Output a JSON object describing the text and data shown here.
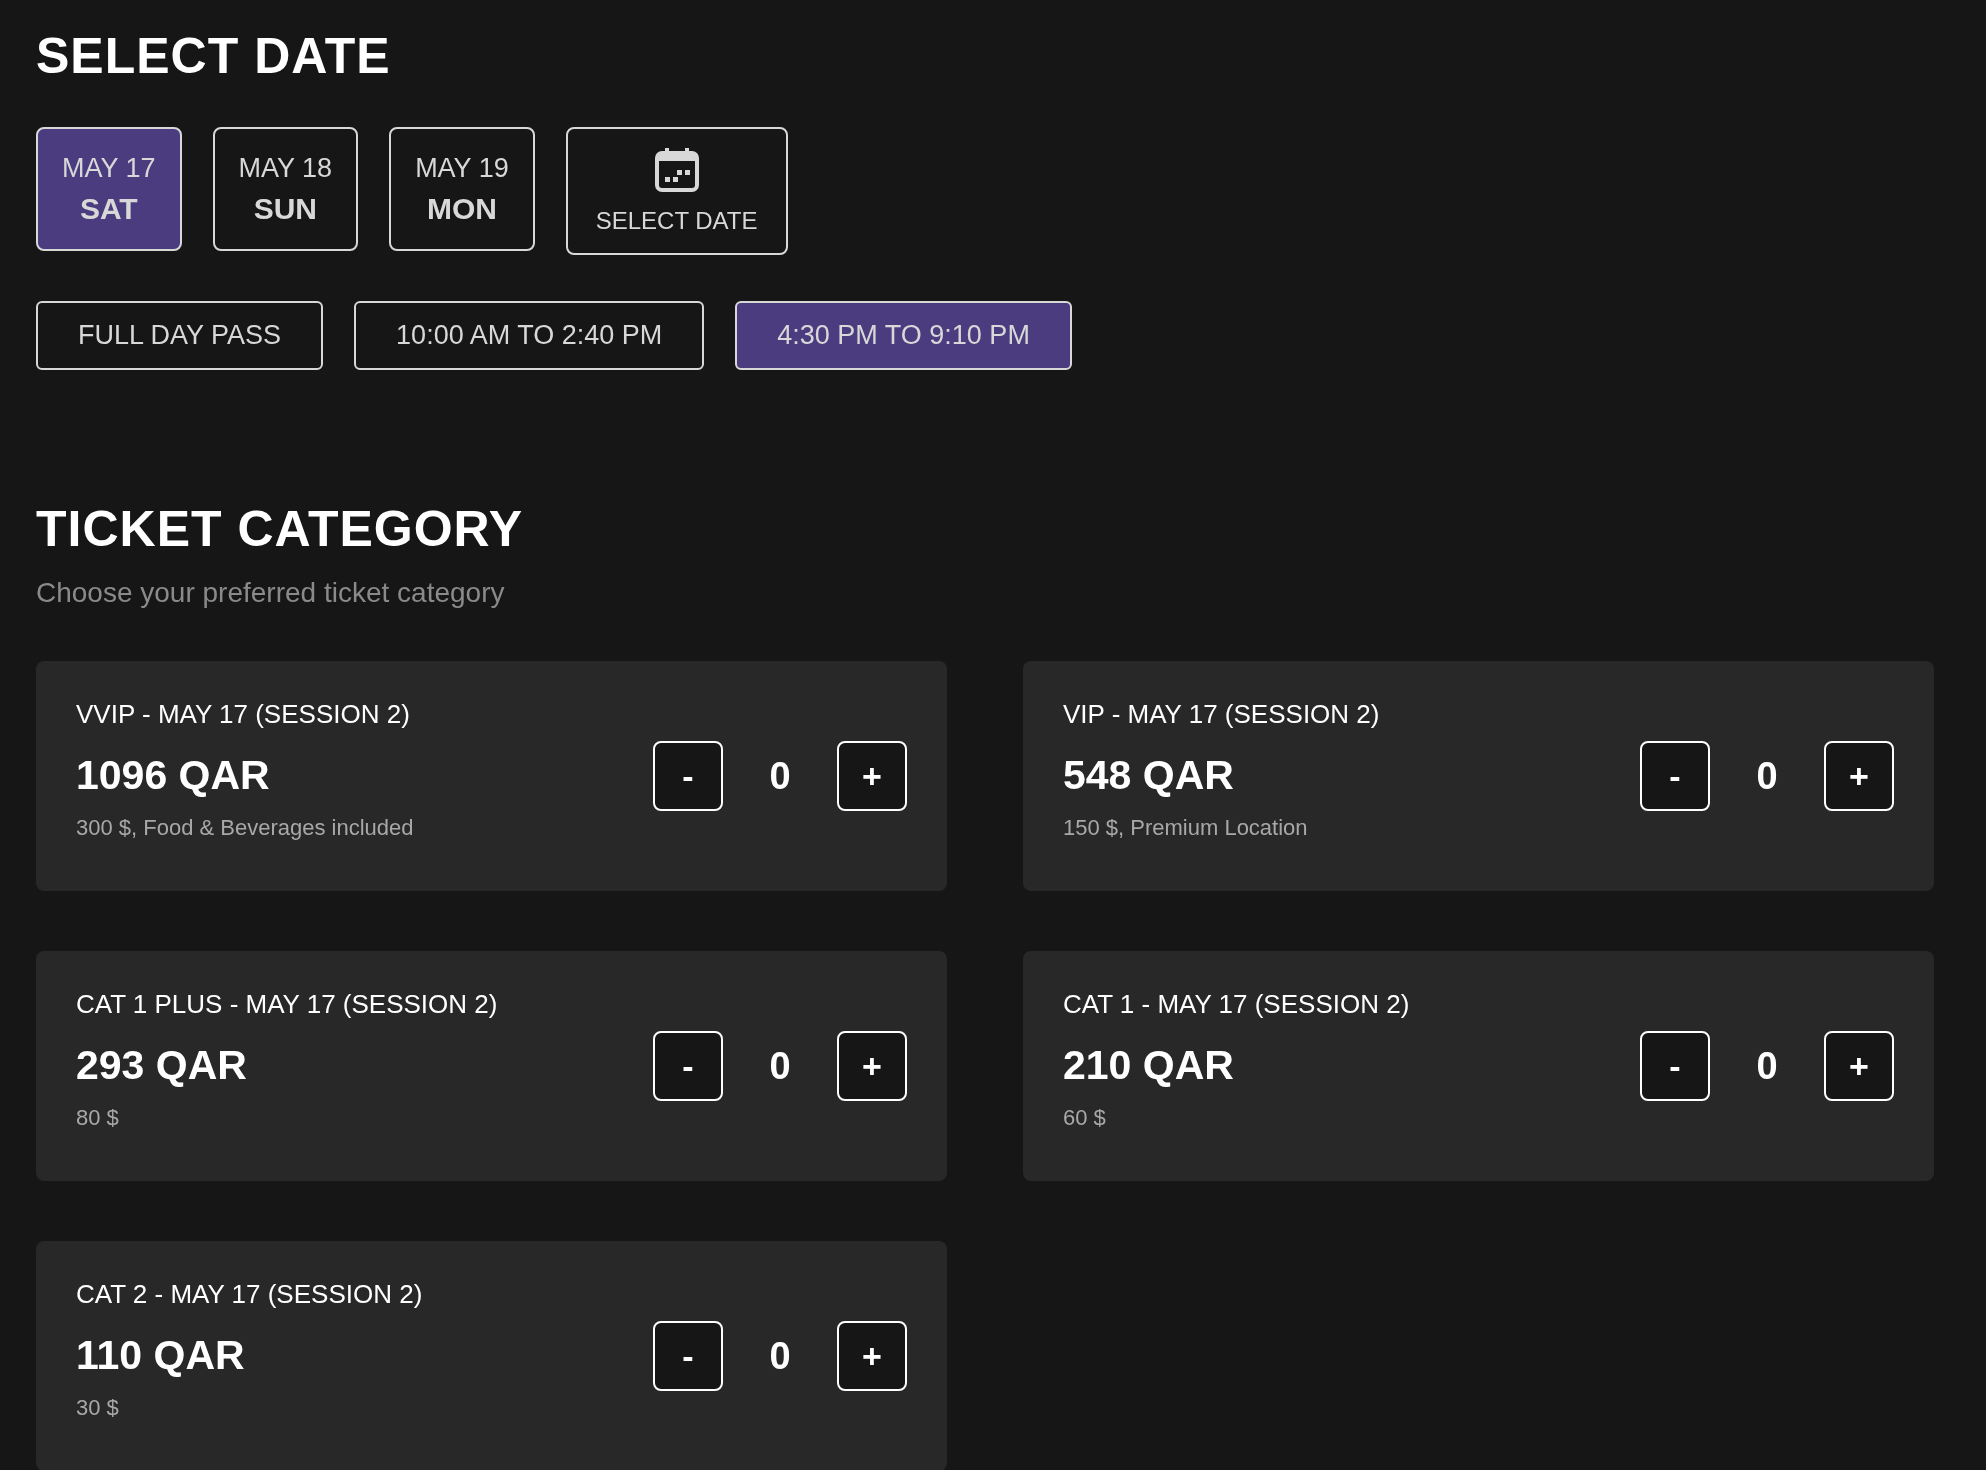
{
  "date_section": {
    "title": "SELECT DATE",
    "dates": [
      {
        "date": "MAY 17",
        "day": "SAT",
        "selected": true
      },
      {
        "date": "MAY 18",
        "day": "SUN",
        "selected": false
      },
      {
        "date": "MAY 19",
        "day": "MON",
        "selected": false
      }
    ],
    "date_picker": {
      "label": "SELECT DATE"
    },
    "sessions": [
      {
        "label": "FULL DAY PASS",
        "selected": false
      },
      {
        "label": "10:00 AM TO 2:40 PM",
        "selected": false
      },
      {
        "label": "4:30 PM TO 9:10 PM",
        "selected": true
      }
    ]
  },
  "ticket_section": {
    "title": "TICKET CATEGORY",
    "subtitle": "Choose your preferred ticket category",
    "minus_label": "-",
    "plus_label": "+",
    "categories": [
      {
        "name": "VVIP - MAY 17 (SESSION 2)",
        "price": "1096 QAR",
        "note": "300 $, Food & Beverages included",
        "quantity": "0"
      },
      {
        "name": "VIP - MAY 17 (SESSION 2)",
        "price": "548 QAR",
        "note": "150 $, Premium Location",
        "quantity": "0"
      },
      {
        "name": "CAT 1 PLUS - MAY 17 (SESSION 2)",
        "price": "293 QAR",
        "note": "80 $",
        "quantity": "0"
      },
      {
        "name": "CAT 1 - MAY 17 (SESSION 2)",
        "price": "210 QAR",
        "note": "60 $",
        "quantity": "0"
      },
      {
        "name": "CAT 2 - MAY 17 (SESSION 2)",
        "price": "110 QAR",
        "note": "30 $",
        "quantity": "0"
      }
    ]
  }
}
